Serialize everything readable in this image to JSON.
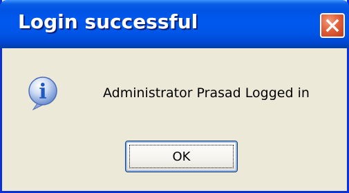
{
  "dialog": {
    "title": "Login successful",
    "message": "Administrator Prasad Logged in",
    "ok_label": "OK",
    "info_glyph": "i"
  },
  "icons": {
    "close": "close-icon",
    "info": "information-icon"
  },
  "colors": {
    "titlebar": "#0054e3",
    "window_border": "#0831d9",
    "dialog_bg": "#ece9d8",
    "close_button": "#e2623c",
    "info_icon": "#1d58c4"
  }
}
